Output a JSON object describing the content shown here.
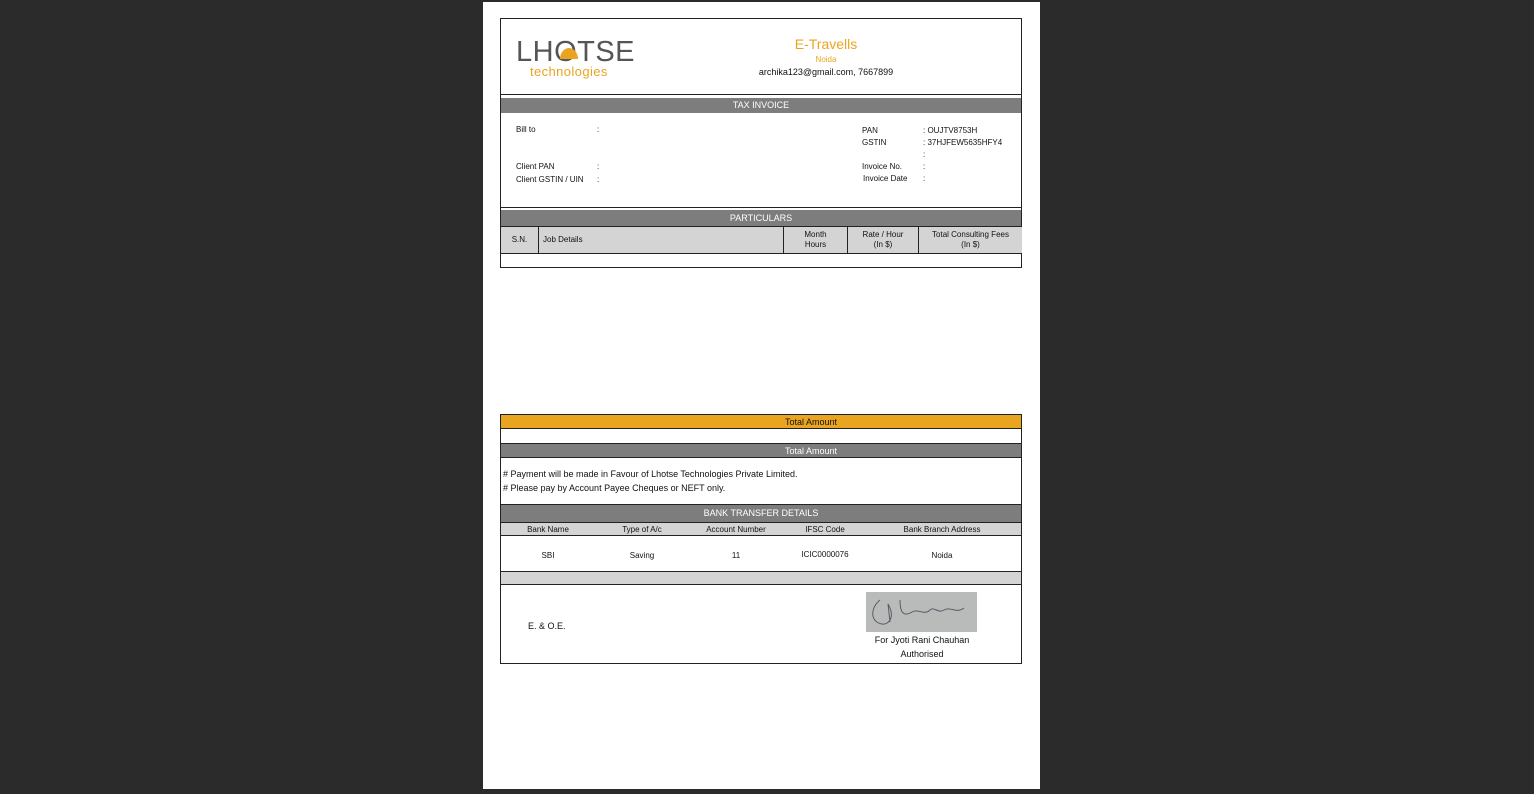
{
  "logo": {
    "main": "LHOTSE",
    "sub": "technologies"
  },
  "company": {
    "name": "E-Travells",
    "city": "Noida",
    "contact": "archika123@gmail.com, 7667899"
  },
  "tax_invoice": {
    "title": "TAX INVOICE",
    "bill_to_label": "Bill to",
    "client_pan_label": "Client PAN",
    "client_gstin_label": "Client GSTIN / UIN",
    "colon": ":",
    "pan_label": "PAN",
    "pan_value": ": OUJTV8753H",
    "gstin_label": "GSTIN",
    "gstin_value": ": 37HJFEW5635HFY4",
    "invoice_no_label": "Invoice No.",
    "invoice_date_label": "Invoice Date"
  },
  "particulars": {
    "title": "PARTICULARS",
    "columns": [
      "S.N.",
      "Job Details",
      "Month\nHours",
      "Rate / Hour\n(In $)",
      "Total Consulting Fees\n(In $)"
    ]
  },
  "totals": {
    "total_amount_label_1": "Total Amount",
    "total_amount_label_2": "Total Amount"
  },
  "notes": {
    "line1": "# Payment will be made in Favour of Lhotse Technologies Private Limited.",
    "line2": "#  Please pay by Account Payee Cheques or NEFT only."
  },
  "bank": {
    "title": "BANK TRANSFER DETAILS",
    "columns": [
      "Bank Name",
      "Type of A/c",
      "Account Number",
      "IFSC Code",
      "Bank Branch Address"
    ],
    "row": [
      "SBI",
      "Saving",
      "11",
      "ICIC0000076",
      "Noida"
    ]
  },
  "footer": {
    "eoe": "E. & O.E.",
    "for_name": "For Jyoti Rani Chauhan",
    "authorised": "Authorised"
  },
  "colors": {
    "accent": "#e9a520",
    "bar_gray": "#7d7d7d",
    "header_gray": "#d4d4d4"
  }
}
